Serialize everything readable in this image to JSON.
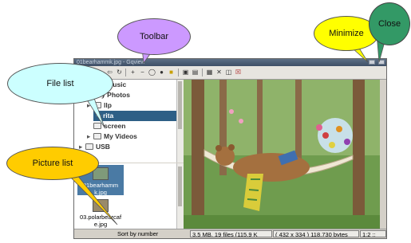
{
  "window": {
    "title": "01bearhammk.jpg - Gqview"
  },
  "toolbar": {
    "icons": [
      "up-arrow-icon",
      "down-arrow-icon",
      "home-icon",
      "back-icon",
      "refresh-icon",
      "zoom-in-icon",
      "zoom-out-icon",
      "zoom-fit-icon",
      "zoom-100-icon",
      "stop-icon",
      "thumbnails-icon",
      "properties-icon",
      "slideshow-icon",
      "cut-icon",
      "delete-icon",
      "close-icon"
    ]
  },
  "folder_tree": {
    "items": [
      {
        "label": "My Music",
        "expanded": false
      },
      {
        "label": "My Photos",
        "expanded": true
      },
      {
        "label": "llp",
        "expanded": false
      },
      {
        "label": "rita",
        "selected": true
      },
      {
        "label": "screen"
      },
      {
        "label": "My Videos",
        "expanded": false
      },
      {
        "label": "USB",
        "expanded": false
      }
    ]
  },
  "thumbnails": [
    {
      "filename": "01bearhammk.jpg",
      "line1": "01bearhamm",
      "line2": "k.jpg",
      "selected": true
    },
    {
      "filename": "03.polarbearcafe.jpg",
      "line1": "03.polarbearcaf",
      "line2": "e.jpg",
      "selected": false
    }
  ],
  "status": {
    "sort": "Sort by number",
    "info": "3.5 MB, 19 files (115.9 K",
    "dims": "( 432 x 334 ) 118,730 bytes",
    "zoom": "1:2 ::"
  },
  "callouts": {
    "toolbar": "Toolbar",
    "file_list": "File list",
    "picture_list": "Picture list",
    "minimize": "Minimize",
    "close": "Close"
  },
  "colors": {
    "toolbar_callout": "#cc99ff",
    "file_list_callout": "#ccffff",
    "picture_list_callout": "#ffcc00",
    "minimize_callout": "#ffff00",
    "close_callout": "#339966",
    "selection": "#2e5f86"
  }
}
